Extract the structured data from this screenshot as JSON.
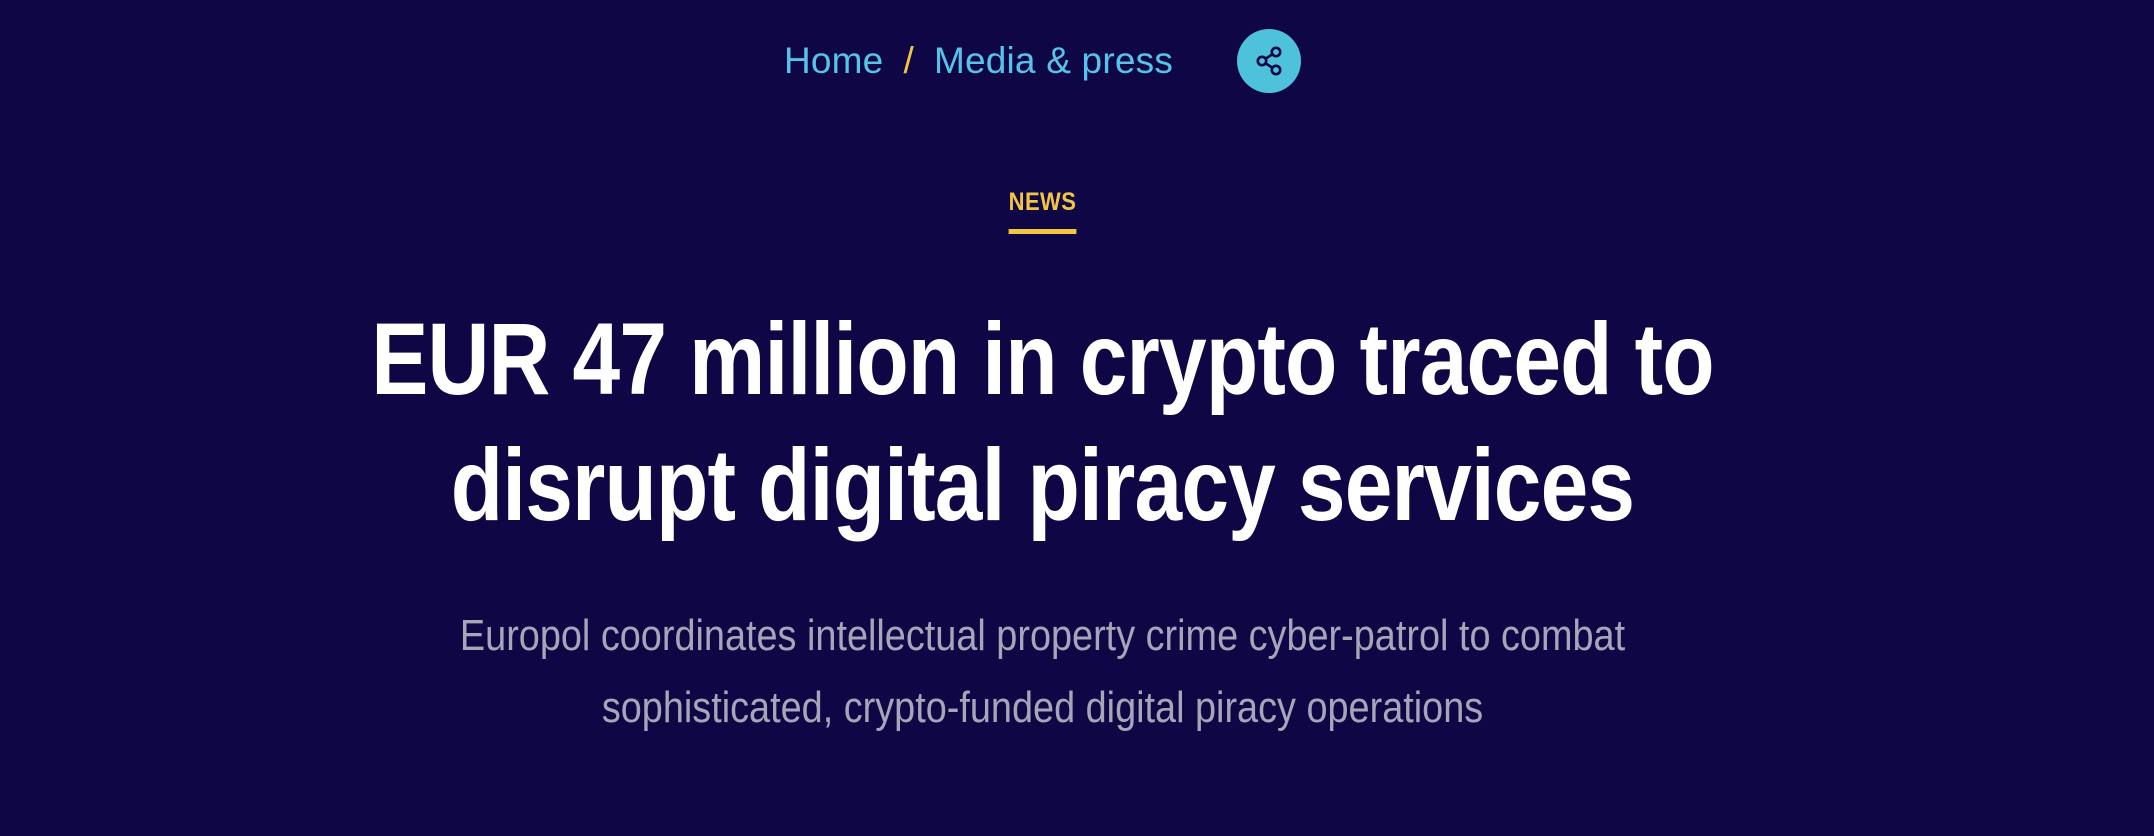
{
  "breadcrumb": {
    "items": [
      "Home",
      "Media & press"
    ],
    "separator": "/"
  },
  "share": {
    "icon": "share-icon"
  },
  "category": {
    "label": "NEWS"
  },
  "article": {
    "title": "EUR 47 million in crypto traced to disrupt digital piracy services",
    "subtitle": "Europol coordinates intellectual property crime cyber-patrol to combat sophisticated, crypto-funded digital piracy operations"
  },
  "colors": {
    "background": "#0f0645",
    "link": "#55c4e8",
    "accent": "#f2c644",
    "share_button": "#4dc2da",
    "title": "#ffffff",
    "subtitle": "#a7a6b8"
  }
}
